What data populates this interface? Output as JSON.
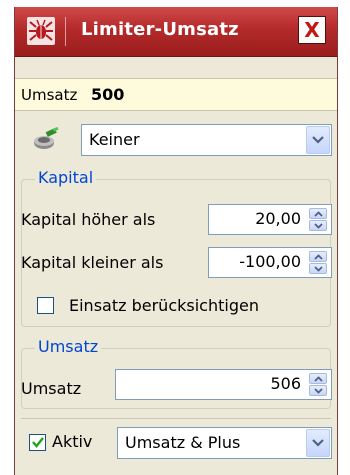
{
  "window": {
    "title": "Limiter-Umsatz",
    "close_label": "X"
  },
  "status": {
    "label": "Umsatz",
    "value": "500"
  },
  "profile_select": {
    "value": "Keiner"
  },
  "kapital": {
    "title": "Kapital",
    "higher_label": "Kapital höher als",
    "higher_value": "20,00",
    "lower_label": "Kapital kleiner als",
    "lower_value": "-100,00",
    "einsatz_label": "Einsatz berücksichtigen",
    "einsatz_checked": false
  },
  "umsatz": {
    "title": "Umsatz",
    "label": "Umsatz",
    "value": "506"
  },
  "footer": {
    "aktiv_label": "Aktiv",
    "aktiv_checked": true,
    "mode_value": "Umsatz &  Plus"
  },
  "colors": {
    "titlebar": "#b52a2a",
    "group_title": "#0046d5",
    "status_bg": "#fdfbdc"
  }
}
